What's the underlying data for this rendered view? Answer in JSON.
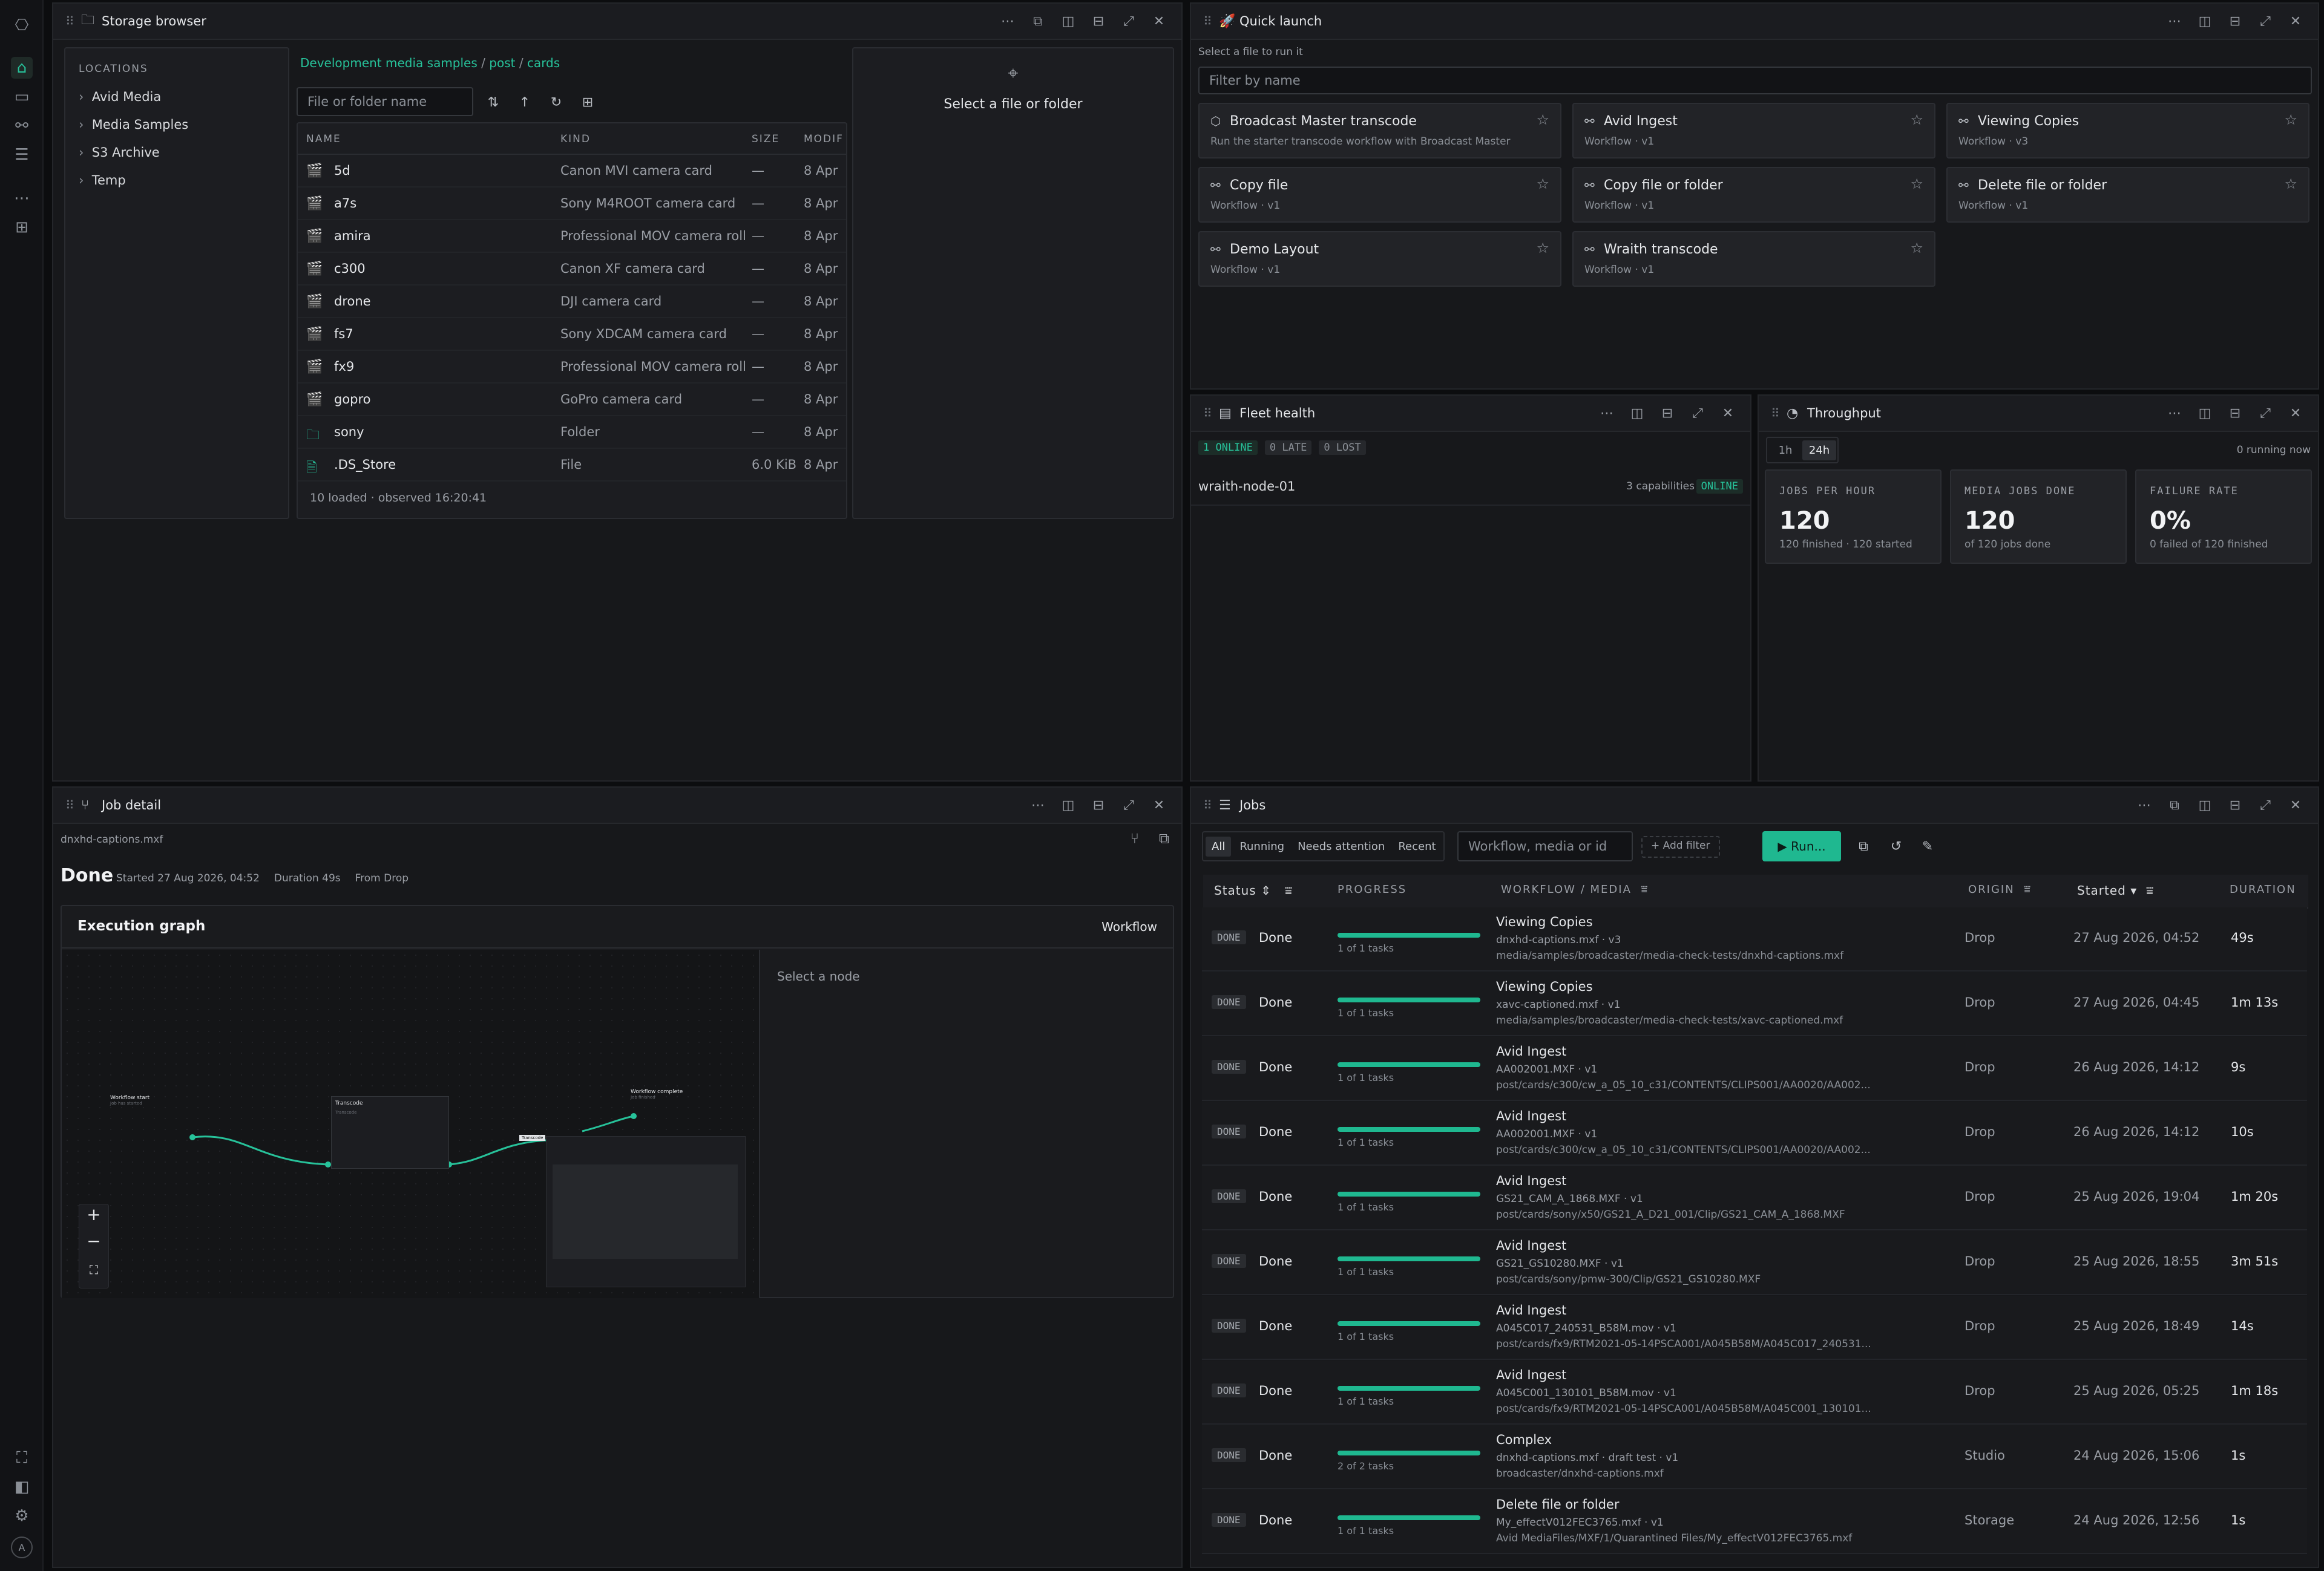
{
  "rail": {
    "icons": [
      "logo-icon",
      "home-icon",
      "inbox-icon",
      "workflow-icon",
      "checklist-icon",
      "more-icon",
      "grid-icon",
      "expand-icon",
      "sidebar-icon",
      "settings-icon"
    ],
    "avatar": "A"
  },
  "storage": {
    "title": "Storage browser",
    "locations_label": "LOCATIONS",
    "locations": [
      "Avid Media",
      "Media Samples",
      "S3 Archive",
      "Temp"
    ],
    "breadcrumb": [
      "Development media samples",
      "post",
      "cards"
    ],
    "breadcrumb_sep": "/",
    "search_placeholder": "File or folder name",
    "cols": [
      "NAME",
      "KIND",
      "SIZE",
      "MODIF"
    ],
    "rows": [
      {
        "name": "5d",
        "kind": "Canon MVI camera card",
        "size": "—",
        "mod": "8 Apr",
        "icon": "camera-card-icon"
      },
      {
        "name": "a7s",
        "kind": "Sony M4ROOT camera card",
        "size": "—",
        "mod": "8 Apr",
        "icon": "camera-card-icon"
      },
      {
        "name": "amira",
        "kind": "Professional MOV camera roll",
        "size": "—",
        "mod": "8 Apr",
        "icon": "camera-card-icon"
      },
      {
        "name": "c300",
        "kind": "Canon XF camera card",
        "size": "—",
        "mod": "8 Apr",
        "icon": "camera-card-icon"
      },
      {
        "name": "drone",
        "kind": "DJI camera card",
        "size": "—",
        "mod": "8 Apr",
        "icon": "camera-card-icon"
      },
      {
        "name": "fs7",
        "kind": "Sony XDCAM camera card",
        "size": "—",
        "mod": "8 Apr",
        "icon": "camera-card-icon"
      },
      {
        "name": "fx9",
        "kind": "Professional MOV camera roll",
        "size": "—",
        "mod": "8 Apr",
        "icon": "camera-card-icon"
      },
      {
        "name": "gopro",
        "kind": "GoPro camera card",
        "size": "—",
        "mod": "8 Apr",
        "icon": "camera-card-icon"
      },
      {
        "name": "sony",
        "kind": "Folder",
        "size": "—",
        "mod": "8 Apr",
        "icon": "folder-icon"
      },
      {
        "name": ".DS_Store",
        "kind": "File",
        "size": "6.0 KiB",
        "mod": "8 Apr",
        "icon": "file-icon"
      }
    ],
    "footer": "10 loaded · observed 16:20:41",
    "preview_msg": "Select a file or folder"
  },
  "quick": {
    "title": "Quick launch",
    "hint": "Select a file to run it",
    "filter_placeholder": "Filter by name",
    "tiles": [
      {
        "name": "Broadcast Master transcode",
        "sub": "Run the starter transcode workflow with Broadcast Master enco..."
      },
      {
        "name": "Avid Ingest",
        "sub": "Workflow · v1"
      },
      {
        "name": "Viewing Copies",
        "sub": "Workflow · v3"
      },
      {
        "name": "Copy file",
        "sub": "Workflow · v1"
      },
      {
        "name": "Copy file or folder",
        "sub": "Workflow · v1"
      },
      {
        "name": "Delete file or folder",
        "sub": "Workflow · v1"
      },
      {
        "name": "Demo Layout",
        "sub": "Workflow · v1"
      },
      {
        "name": "Wraith transcode",
        "sub": "Workflow · v1"
      }
    ]
  },
  "fleet": {
    "title": "Fleet health",
    "badges": [
      "1 ONLINE",
      "0 LATE",
      "0 LOST"
    ],
    "node": "wraith-node-01",
    "caps": "3 capabilities",
    "status": "ONLINE"
  },
  "throughput": {
    "title": "Throughput",
    "ranges": [
      "1h",
      "24h"
    ],
    "running": "0 running now",
    "stats": [
      {
        "label": "JOBS PER HOUR",
        "value": "120",
        "sub": "120 finished · 120 started"
      },
      {
        "label": "MEDIA JOBS DONE",
        "value": "120",
        "sub": "of 120 jobs done"
      },
      {
        "label": "FAILURE RATE",
        "value": "0%",
        "sub": "0 failed of 120 finished"
      }
    ]
  },
  "jobdetail": {
    "title": "Job detail",
    "file": "dnxhd-captions.mxf",
    "status": "Done",
    "started": "Started 27 Aug 2026, 04:52",
    "duration": "Duration 49s",
    "from": "From Drop",
    "graph_title": "Execution graph",
    "graph_tab": "Workflow",
    "select_node": "Select a node",
    "graph": {
      "n1_title": "Workflow start",
      "n1_sub": "Job has started",
      "n2_title": "Transcode",
      "n2_sub": "Transcode",
      "n3_title": "Workflow complete",
      "n3_sub": "Job finished",
      "tag": "Transcode"
    }
  },
  "jobs": {
    "title": "Jobs",
    "tabs": [
      "All",
      "Running",
      "Needs attention",
      "Recent"
    ],
    "search_placeholder": "Workflow, media or id",
    "add_filter": "+ Add filter",
    "run": "Run...",
    "cols": [
      "Status",
      "PROGRESS",
      "WORKFLOW / MEDIA",
      "ORIGIN",
      "Started",
      "DURATION"
    ],
    "rows": [
      {
        "badge": "DONE",
        "status": "Done",
        "progress": 1.0,
        "tasks": "1 of 1 tasks",
        "wf": "Viewing Copies",
        "media": "dnxhd-captions.mxf · v3",
        "path": "media/samples/broadcaster/media-check-tests/dnxhd-captions.mxf",
        "origin": "Drop",
        "started": "27 Aug 2026, 04:52",
        "dur": "49s"
      },
      {
        "badge": "DONE",
        "status": "Done",
        "progress": 1.0,
        "tasks": "1 of 1 tasks",
        "wf": "Viewing Copies",
        "media": "xavc-captioned.mxf · v1",
        "path": "media/samples/broadcaster/media-check-tests/xavc-captioned.mxf",
        "origin": "Drop",
        "started": "27 Aug 2026, 04:45",
        "dur": "1m 13s"
      },
      {
        "badge": "DONE",
        "status": "Done",
        "progress": 1.0,
        "tasks": "1 of 1 tasks",
        "wf": "Avid Ingest",
        "media": "AA002001.MXF · v1",
        "path": "post/cards/c300/cw_a_05_10_c31/CONTENTS/CLIPS001/AA0020/AA002...",
        "origin": "Drop",
        "started": "26 Aug 2026, 14:12",
        "dur": "9s"
      },
      {
        "badge": "DONE",
        "status": "Done",
        "progress": 1.0,
        "tasks": "1 of 1 tasks",
        "wf": "Avid Ingest",
        "media": "AA002001.MXF · v1",
        "path": "post/cards/c300/cw_a_05_10_c31/CONTENTS/CLIPS001/AA0020/AA002...",
        "origin": "Drop",
        "started": "26 Aug 2026, 14:12",
        "dur": "10s"
      },
      {
        "badge": "DONE",
        "status": "Done",
        "progress": 1.0,
        "tasks": "1 of 1 tasks",
        "wf": "Avid Ingest",
        "media": "GS21_CAM_A_1868.MXF · v1",
        "path": "post/cards/sony/x50/GS21_A_D21_001/Clip/GS21_CAM_A_1868.MXF",
        "origin": "Drop",
        "started": "25 Aug 2026, 19:04",
        "dur": "1m 20s"
      },
      {
        "badge": "DONE",
        "status": "Done",
        "progress": 1.0,
        "tasks": "1 of 1 tasks",
        "wf": "Avid Ingest",
        "media": "GS21_GS10280.MXF · v1",
        "path": "post/cards/sony/pmw-300/Clip/GS21_GS10280.MXF",
        "origin": "Drop",
        "started": "25 Aug 2026, 18:55",
        "dur": "3m 51s"
      },
      {
        "badge": "DONE",
        "status": "Done",
        "progress": 1.0,
        "tasks": "1 of 1 tasks",
        "wf": "Avid Ingest",
        "media": "A045C017_240531_B58M.mov · v1",
        "path": "post/cards/fx9/RTM2021-05-14PSCA001/A045B58M/A045C017_240531...",
        "origin": "Drop",
        "started": "25 Aug 2026, 18:49",
        "dur": "14s"
      },
      {
        "badge": "DONE",
        "status": "Done",
        "progress": 1.0,
        "tasks": "1 of 1 tasks",
        "wf": "Avid Ingest",
        "media": "A045C001_130101_B58M.mov · v1",
        "path": "post/cards/fx9/RTM2021-05-14PSCA001/A045B58M/A045C001_130101...",
        "origin": "Drop",
        "started": "25 Aug 2026, 05:25",
        "dur": "1m 18s"
      },
      {
        "badge": "DONE",
        "status": "Done",
        "progress": 1.0,
        "tasks": "2 of 2 tasks",
        "wf": "Complex",
        "media": "dnxhd-captions.mxf · draft test · v1",
        "path": "broadcaster/dnxhd-captions.mxf",
        "origin": "Studio",
        "started": "24 Aug 2026, 15:06",
        "dur": "1s"
      },
      {
        "badge": "DONE",
        "status": "Done",
        "progress": 1.0,
        "tasks": "1 of 1 tasks",
        "wf": "Delete file or folder",
        "media": "My_effectV012FEC3765.mxf · v1",
        "path": "Avid MediaFiles/MXF/1/Quarantined Files/My_effectV012FEC3765.mxf",
        "origin": "Storage",
        "started": "24 Aug 2026, 12:56",
        "dur": "1s"
      }
    ]
  },
  "colors": {
    "accent": "#27c29a",
    "bg": "#0c0d0f",
    "panel": "#17181b"
  }
}
